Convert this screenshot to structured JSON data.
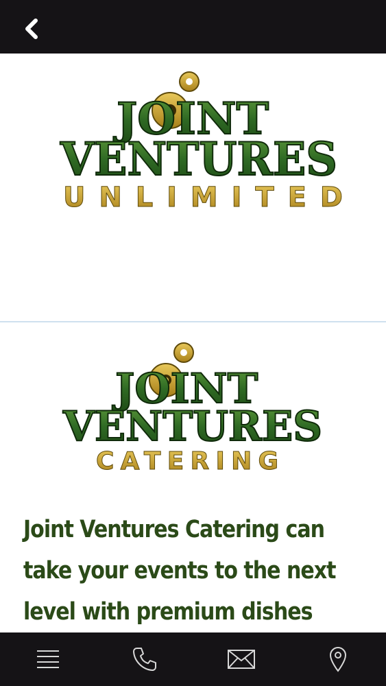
{
  "header": {
    "back_icon": "chevron-left-icon"
  },
  "logo_unlimited": {
    "line1": "JOINT",
    "line2": "VENTURES",
    "line3": "UNLIMITED"
  },
  "logo_catering": {
    "line1": "JOINT",
    "line2": "VENTURES",
    "line3": "CATERING"
  },
  "description": {
    "text": "Joint Ventures Catering can take your events to the next level with premium dishes"
  },
  "bottom_nav": {
    "items": [
      {
        "icon": "menu-icon"
      },
      {
        "icon": "phone-icon"
      },
      {
        "icon": "mail-icon"
      },
      {
        "icon": "location-pin-icon"
      }
    ]
  },
  "colors": {
    "bar_background": "#151316",
    "logo_green": "#2e6b26",
    "logo_gold": "#c9a227",
    "text_green": "#2b4a18"
  }
}
